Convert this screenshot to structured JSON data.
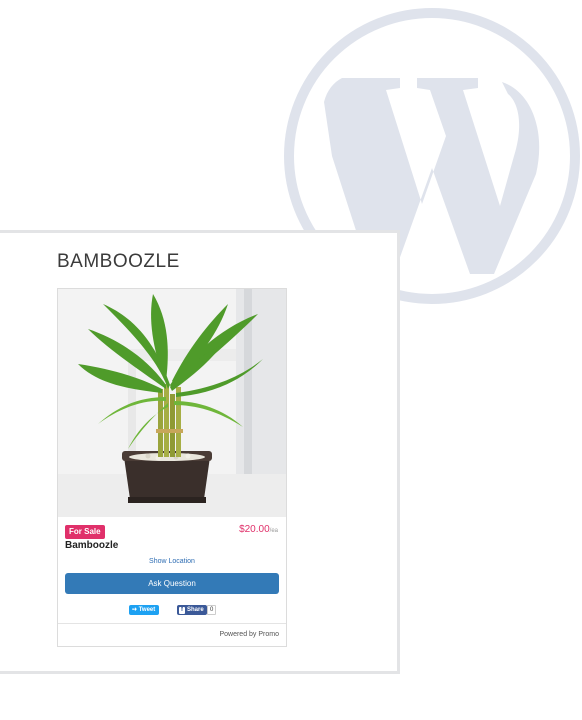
{
  "background_logo": {
    "icon": "wordpress-logo-icon",
    "color": "#dfe3ec"
  },
  "card": {
    "title": "BAMBOOZLE",
    "product": {
      "badge": "For Sale",
      "price": "$20.00",
      "price_unit": "/ea",
      "name": "Bamboozle",
      "show_location": "Show Location",
      "ask_button": "Ask Question",
      "tweet_label": "Tweet",
      "share_label": "Share",
      "share_count": "0",
      "footer": "Powered by Promo"
    },
    "colors": {
      "accent": "#e0306a",
      "button": "#337ab7",
      "link": "#2e6db3"
    }
  }
}
